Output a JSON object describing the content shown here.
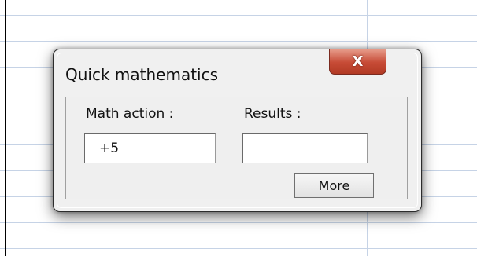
{
  "dialog": {
    "title": "Quick mathematics",
    "close_label": "X"
  },
  "form": {
    "math_action_label": "Math action :",
    "math_action_value": "+5",
    "results_label": "Results :",
    "results_value": "",
    "more_label": "More"
  },
  "colors": {
    "grid_line": "#c6d3e6",
    "close_button": "#c74b36",
    "dialog_bg": "#f0f0f0"
  }
}
